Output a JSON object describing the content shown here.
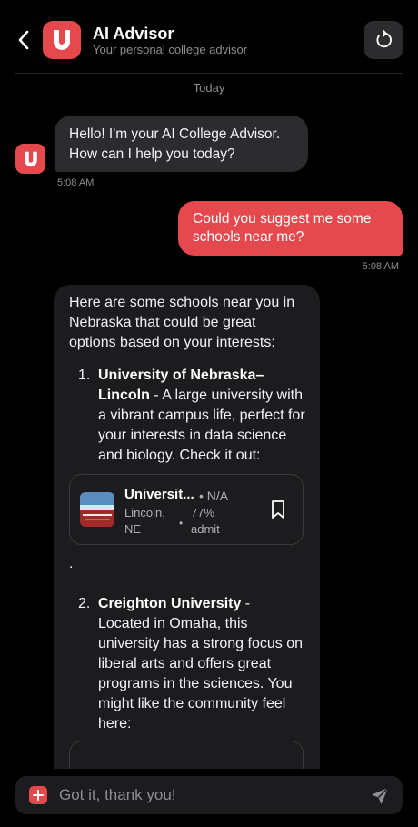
{
  "header": {
    "title": "AI Advisor",
    "subtitle": "Your personal college advisor",
    "logo_letter": "U",
    "back_icon": "chevron-left-icon",
    "refresh_icon": "refresh-icon"
  },
  "chat": {
    "date_separator": "Today",
    "bot_avatar_letter": "U",
    "messages": [
      {
        "role": "bot",
        "text": "Hello! I'm your AI College Advisor. How can I help you today?",
        "time": "5:08 AM"
      },
      {
        "role": "user",
        "text": "Could you suggest me some schools near me?",
        "time": "5:08 AM"
      },
      {
        "role": "bot",
        "intro": "Here are some schools near you in Nebraska that could be great options based on your interests:",
        "items": [
          {
            "num": "1.",
            "name": "University of Nebraska–Lincoln",
            "desc": " - A large university with a vibrant campus life, perfect for your interests in data science and biology. Check it out:",
            "card": {
              "name": "Universit...",
              "rating": "• N/A",
              "location": "Lincoln, NE",
              "sep": "•",
              "admit": "77% admit",
              "bookmark_icon": "bookmark-icon"
            }
          },
          {
            "num": "2.",
            "name": "Creighton University",
            "desc": " - Located in Omaha, this university has a strong focus on liberal arts and offers great programs in the sciences. You might like the community feel here:"
          }
        ],
        "after_card": "."
      }
    ]
  },
  "input": {
    "placeholder": "Got it, thank you!",
    "plus_icon": "plus-icon",
    "send_icon": "send-icon"
  },
  "colors": {
    "accent": "#e5484d",
    "background": "#000000",
    "bubble_bot": "#2c2c2e",
    "bubble_bot_long": "#1c1c1e"
  }
}
